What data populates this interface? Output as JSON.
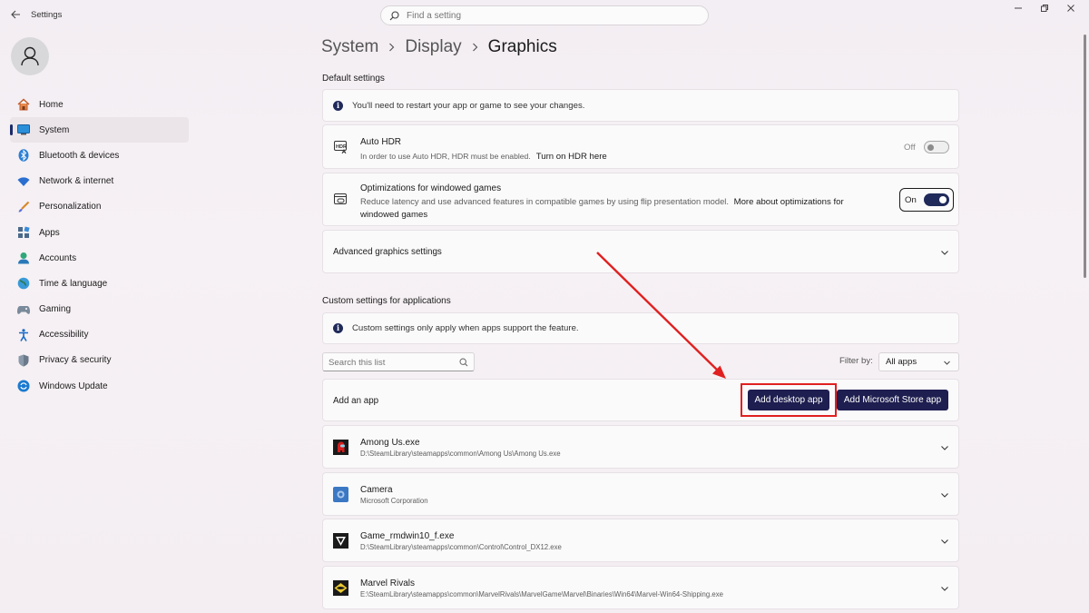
{
  "window": {
    "title": "Settings",
    "search_placeholder": "Find a setting",
    "controls": [
      "minimize-icon",
      "restore-icon",
      "close-icon"
    ]
  },
  "sidebar": {
    "items": [
      {
        "label": "Home",
        "icon": "home-icon"
      },
      {
        "label": "System",
        "icon": "system-icon",
        "active": true
      },
      {
        "label": "Bluetooth & devices",
        "icon": "bluetooth-icon"
      },
      {
        "label": "Network & internet",
        "icon": "wifi-icon"
      },
      {
        "label": "Personalization",
        "icon": "brush-icon"
      },
      {
        "label": "Apps",
        "icon": "apps-icon"
      },
      {
        "label": "Accounts",
        "icon": "accounts-icon"
      },
      {
        "label": "Time & language",
        "icon": "globe-icon"
      },
      {
        "label": "Gaming",
        "icon": "gaming-icon"
      },
      {
        "label": "Accessibility",
        "icon": "accessibility-icon"
      },
      {
        "label": "Privacy & security",
        "icon": "shield-icon"
      },
      {
        "label": "Windows Update",
        "icon": "update-icon"
      }
    ]
  },
  "breadcrumb": [
    "System",
    "Display",
    "Graphics"
  ],
  "default_settings": {
    "title": "Default settings",
    "notice": "You'll need to restart your app or game to see your changes.",
    "auto_hdr": {
      "title": "Auto HDR",
      "subtitle": "In order to use Auto HDR, HDR must be enabled.",
      "link": "Turn on HDR here",
      "state": "Off"
    },
    "windowed_games": {
      "title": "Optimizations for windowed games",
      "subtitle": "Reduce latency and use advanced features in compatible games by using flip presentation model.",
      "link_part1": "More about optimizations for",
      "link_part2": "windowed games",
      "state": "On"
    },
    "advanced": "Advanced graphics settings"
  },
  "custom_settings": {
    "title": "Custom settings for applications",
    "notice": "Custom settings only apply when apps support the feature.",
    "search_placeholder": "Search this list",
    "filter_label": "Filter by:",
    "filter_value": "All apps",
    "add_app_label": "Add an app",
    "add_desktop_button": "Add desktop app",
    "add_store_button": "Add Microsoft Store app"
  },
  "apps": [
    {
      "name": "Among Us.exe",
      "path": "D:\\SteamLibrary\\steamapps\\common\\Among Us\\Among Us.exe",
      "icon": "among-us-icon"
    },
    {
      "name": "Camera",
      "path": "Microsoft Corporation",
      "icon": "camera-icon"
    },
    {
      "name": "Game_rmdwin10_f.exe",
      "path": "D:\\SteamLibrary\\steamapps\\common\\Control\\Control_DX12.exe",
      "icon": "control-game-icon"
    },
    {
      "name": "Marvel Rivals",
      "path": "E:\\SteamLibrary\\steamapps\\common\\MarvelRivals\\MarvelGame\\Marvel\\Binaries\\Win64\\Marvel-Win64-Shipping.exe",
      "icon": "marvel-rivals-icon"
    }
  ],
  "colors": {
    "accent": "#1e1e50",
    "highlight": "#e02020"
  }
}
